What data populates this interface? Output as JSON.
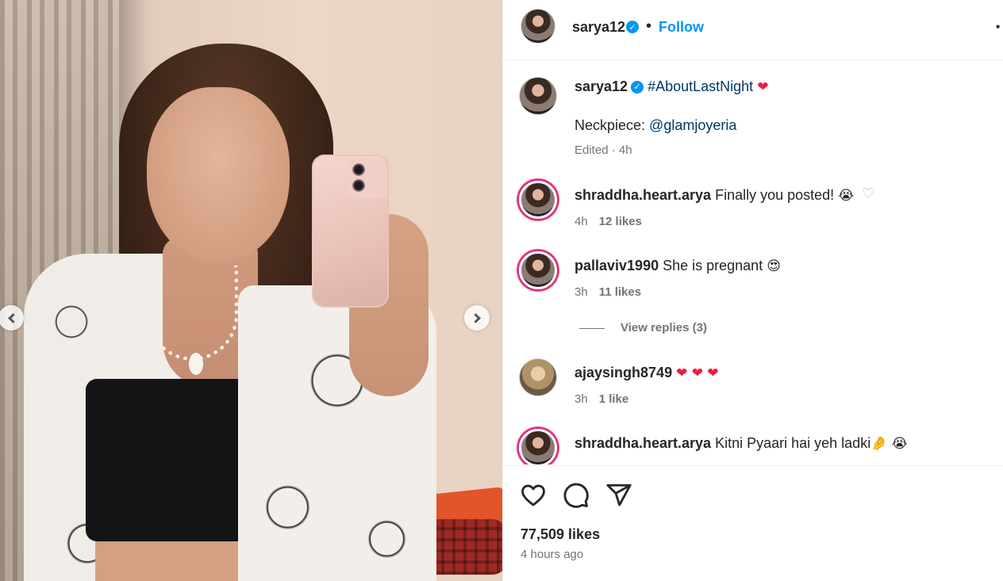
{
  "post": {
    "author": "sarya12",
    "follow_label": "Follow",
    "separator": "•",
    "more_label": "·",
    "verified_mark": "✓",
    "caption": {
      "username": "sarya12",
      "hashtag": "#AboutLastNight",
      "heart": "❤",
      "line2_prefix": "Neckpiece: ",
      "mention": "@glamjoyeria",
      "meta": "Edited · 4h"
    },
    "likes_count": "77,509 likes",
    "time_ago": "4 hours ago"
  },
  "comments": [
    {
      "username": "shraddha.heart.arya",
      "text": "Finally you posted! ",
      "emoji": "😭",
      "time": "4h",
      "likes": "12 likes",
      "like_icon": "♡"
    },
    {
      "username": "pallaviv1990",
      "text": "She is pregnant ",
      "emoji": "😍",
      "time": "3h",
      "likes": "11 likes"
    },
    {
      "username": "ajaysingh8749",
      "text": " ",
      "emoji": "❤ ❤ ❤",
      "time": "3h",
      "likes": "1 like"
    },
    {
      "username": "shraddha.heart.arya",
      "text": "Kitni Pyaari hai yeh ladki",
      "emoji": "🤌 😭"
    }
  ],
  "view_replies": "View replies (3)",
  "icons": {
    "like": "heart-icon",
    "comment": "comment-icon",
    "share": "share-icon",
    "prev": "chevron-left-icon",
    "next": "chevron-right-icon"
  },
  "colors": {
    "accent": "#0095f6",
    "link": "#00376b",
    "heart": "#ed1c3c",
    "muted": "#737373"
  }
}
